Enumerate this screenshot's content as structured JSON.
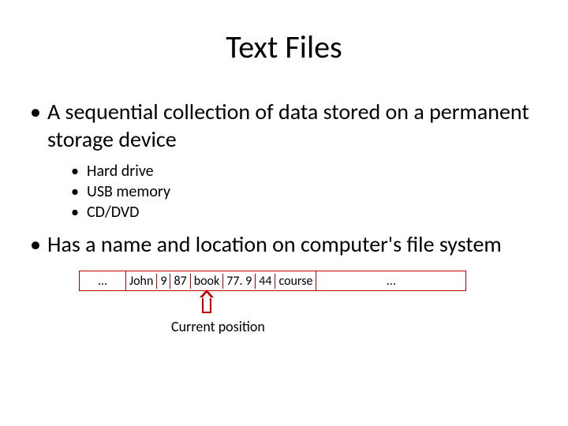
{
  "title": "Text Files",
  "bullets": {
    "b1": "A sequential collection of data stored on a permanent storage device",
    "sub": {
      "s1": "Hard drive",
      "s2": "USB memory",
      "s3": "CD/DVD"
    },
    "b2": "Has a name and location on computer's file system"
  },
  "record": {
    "left_dots": "…",
    "cells": {
      "c0": "John",
      "c1": "9",
      "c2": "87",
      "c3": "book",
      "c4": "77. 9",
      "c5": "44",
      "c6": "course"
    },
    "right_dots": "…"
  },
  "caption": "Current position"
}
